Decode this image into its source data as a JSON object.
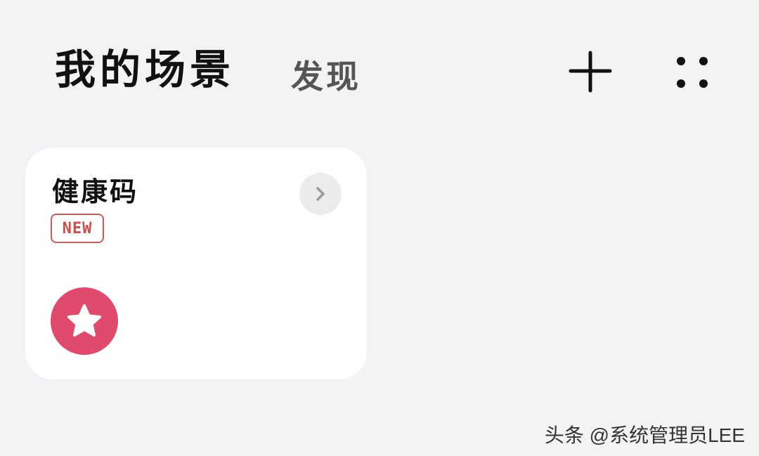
{
  "header": {
    "tabs": [
      {
        "label": "我的场景",
        "active": true
      },
      {
        "label": "发现",
        "active": false
      }
    ],
    "add_icon": "plus-icon",
    "more_icon": "four-dots-icon"
  },
  "scene_cards": [
    {
      "title": "健康码",
      "badge": "NEW",
      "badge_color": "#cc4e4e",
      "open_icon": "chevron-right-icon",
      "scene_icon": "star-icon",
      "icon_bg_color": "#e24a6c"
    }
  ],
  "watermark": {
    "text": "头条 @系统管理员LEE"
  }
}
